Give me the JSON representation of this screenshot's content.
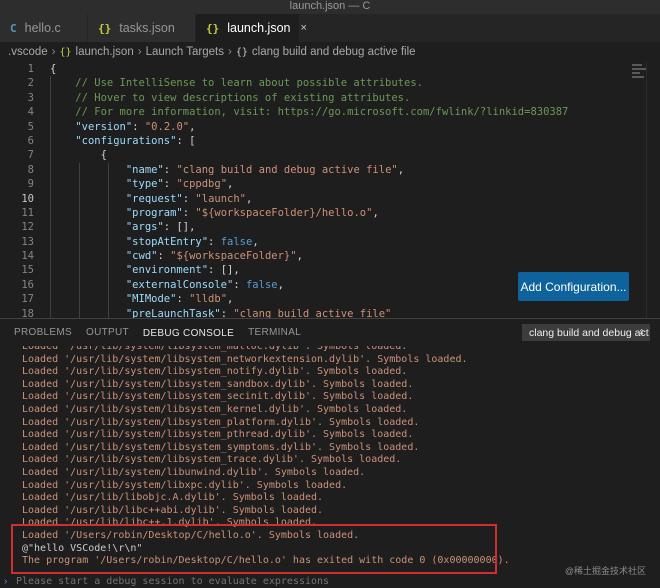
{
  "window": {
    "title": "launch.json — C"
  },
  "tabs": [
    {
      "label": "hello.c",
      "icon": "c-file-icon",
      "glyph": "C"
    },
    {
      "label": "tasks.json",
      "icon": "json-braces-icon",
      "glyph": "{}"
    },
    {
      "label": "launch.json",
      "icon": "json-braces-icon",
      "glyph": "{}",
      "close": "×"
    }
  ],
  "breadcrumb": {
    "items": [
      ".vscode",
      "launch.json",
      "Launch Targets",
      "clang build and debug active file"
    ],
    "separator": "›",
    "json_glyph": "{}",
    "object_glyph": "{}"
  },
  "editor": {
    "current_line": 10,
    "lines": [
      {
        "n": "1",
        "text": "{"
      },
      {
        "n": "2",
        "text": "    // Use IntelliSense to learn about possible attributes."
      },
      {
        "n": "3",
        "text": "    // Hover to view descriptions of existing attributes."
      },
      {
        "n": "4",
        "pre": "    // For more information, visit: ",
        "url": "https://go.microsoft.com/fwlink/?linkid=830387"
      },
      {
        "n": "5",
        "indent": "    ",
        "key": "\"version\"",
        "val": "\"0.2.0\"",
        "tail": ","
      },
      {
        "n": "6",
        "indent": "    ",
        "key": "\"configurations\"",
        "raw": "["
      },
      {
        "n": "7",
        "text": "        {"
      },
      {
        "n": "8",
        "indent": "            ",
        "key": "\"name\"",
        "val": "\"clang build and debug active file\"",
        "tail": ","
      },
      {
        "n": "9",
        "indent": "            ",
        "key": "\"type\"",
        "val": "\"cppdbg\"",
        "tail": ","
      },
      {
        "n": "10",
        "indent": "            ",
        "key": "\"request\"",
        "val": "\"launch\"",
        "tail": ","
      },
      {
        "n": "11",
        "indent": "            ",
        "key": "\"program\"",
        "val": "\"${workspaceFolder}/hello.o\"",
        "tail": ","
      },
      {
        "n": "12",
        "indent": "            ",
        "key": "\"args\"",
        "raw": "[],"
      },
      {
        "n": "13",
        "indent": "            ",
        "key": "\"stopAtEntry\"",
        "kw": "false",
        "tail": ","
      },
      {
        "n": "14",
        "indent": "            ",
        "key": "\"cwd\"",
        "val": "\"${workspaceFolder}\"",
        "tail": ","
      },
      {
        "n": "15",
        "indent": "            ",
        "key": "\"environment\"",
        "raw": "[],"
      },
      {
        "n": "16",
        "indent": "            ",
        "key": "\"externalConsole\"",
        "kw": "false",
        "tail": ","
      },
      {
        "n": "17",
        "indent": "            ",
        "key": "\"MIMode\"",
        "val": "\"lldb\"",
        "tail": ","
      },
      {
        "n": "18",
        "indent": "            ",
        "key": "\"preLaunchTask\"",
        "val": "\"clang build active file\"",
        "tail": ""
      }
    ]
  },
  "add_configuration_button": "Add Configuration...",
  "panel": {
    "tabs": [
      "PROBLEMS",
      "OUTPUT",
      "DEBUG CONSOLE",
      "TERMINAL"
    ],
    "active_tab": "DEBUG CONSOLE",
    "dropdown_value": "clang build and debug act",
    "dropdown_arrow": "⇕"
  },
  "console": {
    "lines": [
      "Loaded '/usr/lib/system/libsystem_malloc.dylib'. Symbols loaded.",
      "Loaded '/usr/lib/system/libsystem_networkextension.dylib'. Symbols loaded.",
      "Loaded '/usr/lib/system/libsystem_notify.dylib'. Symbols loaded.",
      "Loaded '/usr/lib/system/libsystem_sandbox.dylib'. Symbols loaded.",
      "Loaded '/usr/lib/system/libsystem_secinit.dylib'. Symbols loaded.",
      "Loaded '/usr/lib/system/libsystem_kernel.dylib'. Symbols loaded.",
      "Loaded '/usr/lib/system/libsystem_platform.dylib'. Symbols loaded.",
      "Loaded '/usr/lib/system/libsystem_pthread.dylib'. Symbols loaded.",
      "Loaded '/usr/lib/system/libsystem_symptoms.dylib'. Symbols loaded.",
      "Loaded '/usr/lib/system/libsystem_trace.dylib'. Symbols loaded.",
      "Loaded '/usr/lib/system/libunwind.dylib'. Symbols loaded.",
      "Loaded '/usr/lib/system/libxpc.dylib'. Symbols loaded.",
      "Loaded '/usr/lib/libobjc.A.dylib'. Symbols loaded.",
      "Loaded '/usr/lib/libc++abi.dylib'. Symbols loaded.",
      "Loaded '/usr/lib/libc++.1.dylib'. Symbols loaded.",
      "Loaded '/Users/robin/Desktop/C/hello.o'. Symbols loaded.",
      "@\"hello VSCode!\\r\\n\"",
      "The program '/Users/robin/Desktop/C/hello.o' has exited with code 0 (0x00000000)."
    ],
    "input_placeholder": "Please start a debug session to evaluate expressions",
    "input_prompt": "›",
    "watermark": "@稀土掘金技术社区"
  },
  "colors": {
    "accent_button": "#0e639c",
    "highlight_box": "#d12f2f",
    "console_text": "#ce9178",
    "comment": "#6a9955",
    "json_key": "#9cdcfe",
    "json_string": "#ce9178"
  }
}
